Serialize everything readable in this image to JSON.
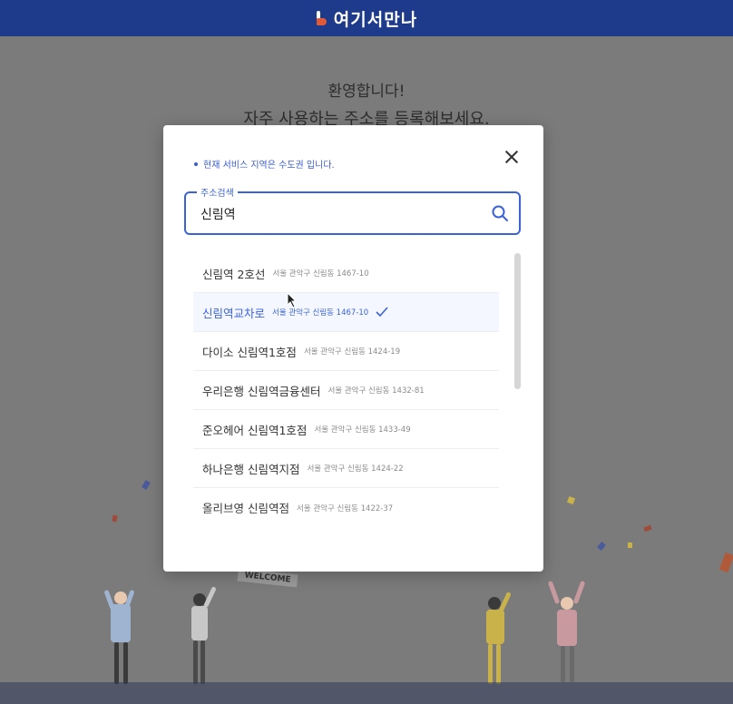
{
  "header": {
    "brand": "여기서만나"
  },
  "welcome": {
    "line1": "환영합니다!",
    "line2": "자주 사용하는 주소를 등록해보세요."
  },
  "background": {
    "banner_text": "WELCOME"
  },
  "modal": {
    "notice": "현재 서비스 지역은 수도권 입니다.",
    "search": {
      "legend": "주소검색",
      "value": "신림역"
    },
    "results": [
      {
        "name": "신림역 2호선",
        "address": "서울 관악구 신림동 1467-10",
        "selected": false
      },
      {
        "name": "신림역교차로",
        "address": "서울 관악구 신림동 1467-10",
        "selected": true
      },
      {
        "name": "다이소 신림역1호점",
        "address": "서울 관악구 신림동 1424-19",
        "selected": false
      },
      {
        "name": "우리은행 신림역금융센터",
        "address": "서울 관악구 신림동 1432-81",
        "selected": false
      },
      {
        "name": "준오헤어 신림역1호점",
        "address": "서울 관악구 신림동 1433-49",
        "selected": false
      },
      {
        "name": "하나은행 신림역지점",
        "address": "서울 관악구 신림동 1424-22",
        "selected": false
      },
      {
        "name": "올리브영 신림역점",
        "address": "서울 관악구 신림동 1422-37",
        "selected": false
      }
    ]
  },
  "colors": {
    "brand": "#1e3a8a",
    "accent": "#3a63d8"
  }
}
